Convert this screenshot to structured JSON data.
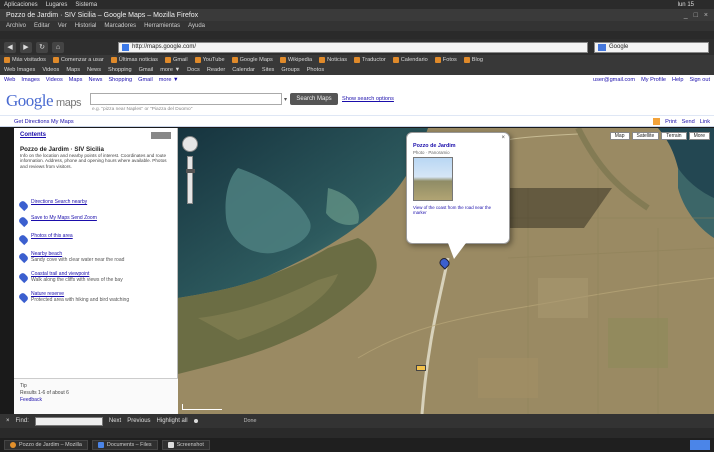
{
  "os_bar": {
    "items": [
      "Aplicaciones",
      "Lugares",
      "Sistema"
    ],
    "tray_text": "lun 15"
  },
  "window": {
    "title": "Pozzo de Jardim · SIV Sicilia – Google Maps – Mozilla Firefox",
    "controls": [
      "_",
      "□",
      "×"
    ]
  },
  "menubar": [
    "Archivo",
    "Editar",
    "Ver",
    "Historial",
    "Marcadores",
    "Herramientas",
    "Ayuda"
  ],
  "navbar": {
    "url": "http://maps.google.com/",
    "search_engine": "Google"
  },
  "bookmarks_row1": [
    "Más visitados",
    "Comenzar a usar",
    "Últimas noticias",
    "Gmail",
    "YouTube",
    "Google Maps",
    "Wikipedia",
    "Noticias",
    "Traductor",
    "Calendario",
    "Fotos",
    "Blog"
  ],
  "bookmarks_row2": [
    "Web Images",
    "Videos",
    "Maps",
    "News",
    "Shopping",
    "Gmail",
    "more ▼",
    "Docs",
    "Reader",
    "Calendar",
    "Sites",
    "Groups",
    "Photos"
  ],
  "google_bar": {
    "left_links": [
      "Web",
      "Images",
      "Videos",
      "Maps",
      "News",
      "Shopping",
      "Gmail",
      "more ▼"
    ],
    "right_links": [
      "user@gmail.com",
      "My Profile",
      "Help",
      "Sign out"
    ]
  },
  "maps_header": {
    "logo_word": "Google",
    "logo_suffix": "maps",
    "search_hint": "e.g. \"pizza near Naples\" or \"Piazza del Duomo\"",
    "search_options": "▾",
    "search_button": "Search Maps",
    "show_options_link": "Show search options"
  },
  "subbar": {
    "left": "Get Directions  My Maps",
    "right": [
      "Print",
      "Send",
      "Link"
    ]
  },
  "panel": {
    "header_link": "Contents",
    "result_title": "Pozzo de Jardim · SIV Sicilia",
    "result_desc": "Info on the location and nearby points of interest. Coordinates and route information. Address, phone and opening hours where available. Photos and reviews from visitors.",
    "entries": [
      {
        "link": "Directions  Search nearby",
        "sub": ""
      },
      {
        "link": "Save to My Maps  Send  Zoom",
        "sub": ""
      },
      {
        "link": "Photos of this area",
        "sub": ""
      },
      {
        "link": "Nearby beach",
        "sub": "Sandy cove with clear water near the road"
      },
      {
        "link": "Coastal trail and viewpoint",
        "sub": "Walk along the cliffs with views of the bay"
      },
      {
        "link": "Nature reserve",
        "sub": "Protected area with hiking and bird watching"
      }
    ],
    "footer_lines": [
      "Tip",
      "Results 1-6 of about 6",
      "Feedback"
    ]
  },
  "map": {
    "type_buttons": [
      "Map",
      "Satellite",
      "Terrain",
      "More"
    ],
    "bubble": {
      "title": "Pozzo de Jardim",
      "subtitle": "Photo · Panoramio",
      "caption": "View of the coast from the road near the marker",
      "close": "×"
    },
    "road_badge": "SS"
  },
  "find_bar": {
    "label": "Find:",
    "buttons": [
      "Next",
      "Previous",
      "Highlight all"
    ],
    "status": "Done"
  },
  "taskbar": {
    "tasks": [
      {
        "label": "Pozzo de Jardim – Mozilla",
        "kind": "a"
      },
      {
        "label": "Documents – Files",
        "kind": "b"
      },
      {
        "label": "Screenshot",
        "kind": "c"
      }
    ]
  },
  "colors": {
    "link": "#1a0dab",
    "sea_deep": "#1d3a44",
    "sea_shallow": "#4a7a7a",
    "land": "#9c8c65",
    "marker": "#3b5fcf"
  }
}
